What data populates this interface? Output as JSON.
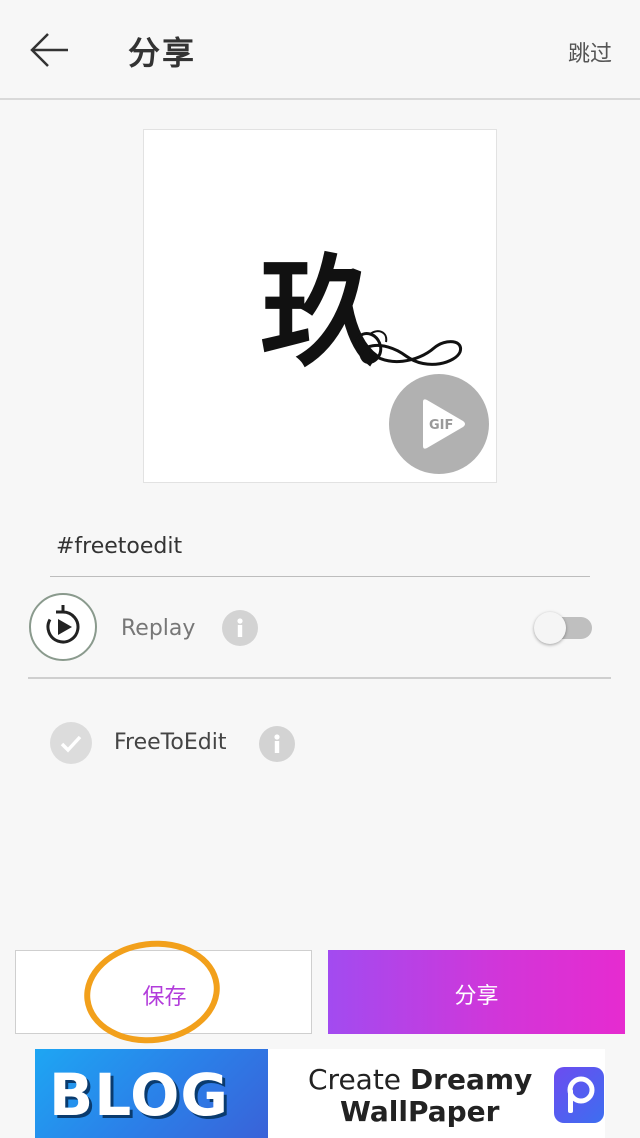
{
  "header": {
    "title": "分享",
    "skip_label": "跳过"
  },
  "preview": {
    "artwork_glyph": "玖",
    "badge": "GIF"
  },
  "caption": {
    "text": "#freetoedit"
  },
  "replay": {
    "label": "Replay",
    "toggle_on": false
  },
  "free_to_edit": {
    "label": "FreeToEdit",
    "checked": true
  },
  "actions": {
    "save_label": "保存",
    "share_label": "分享"
  },
  "ad": {
    "blog_text": "BLOG",
    "line1_prefix": "Create ",
    "line1_bold": "Dreamy",
    "line2": "WallPaper"
  },
  "colors": {
    "share_gradient_start": "#a24bf0",
    "share_gradient_end": "#e62bd0",
    "save_text": "#b23cdb",
    "annotation_circle": "#f2a01b"
  }
}
